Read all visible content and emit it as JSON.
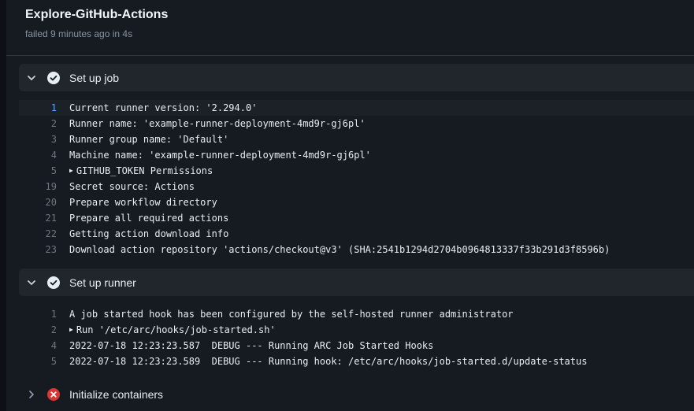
{
  "header": {
    "title": "Explore-GitHub-Actions",
    "subtitle": "failed 9 minutes ago in 4s"
  },
  "steps": [
    {
      "label": "Set up job",
      "status": "success",
      "icon": "check-circle-icon",
      "expanded": true,
      "lines": [
        {
          "num": "1",
          "text": "Current runner version: '2.294.0'",
          "highlight": true
        },
        {
          "num": "2",
          "text": "Runner name: 'example-runner-deployment-4md9r-gj6pl'"
        },
        {
          "num": "3",
          "text": "Runner group name: 'Default'"
        },
        {
          "num": "4",
          "text": "Machine name: 'example-runner-deployment-4md9r-gj6pl'"
        },
        {
          "num": "5",
          "text": "GITHUB_TOKEN Permissions",
          "collapsible": true
        },
        {
          "num": "19",
          "text": "Secret source: Actions"
        },
        {
          "num": "20",
          "text": "Prepare workflow directory"
        },
        {
          "num": "21",
          "text": "Prepare all required actions"
        },
        {
          "num": "22",
          "text": "Getting action download info"
        },
        {
          "num": "23",
          "text": "Download action repository 'actions/checkout@v3' (SHA:2541b1294d2704b0964813337f33b291d3f8596b)"
        }
      ]
    },
    {
      "label": "Set up runner",
      "status": "success",
      "icon": "check-circle-icon",
      "expanded": true,
      "lines": [
        {
          "num": "1",
          "text": "A job started hook has been configured by the self-hosted runner administrator"
        },
        {
          "num": "2",
          "text": "Run '/etc/arc/hooks/job-started.sh'",
          "collapsible": true
        },
        {
          "num": "4",
          "text": "2022-07-18 12:23:23.587  DEBUG --- Running ARC Job Started Hooks"
        },
        {
          "num": "5",
          "text": "2022-07-18 12:23:23.589  DEBUG --- Running hook: /etc/arc/hooks/job-started.d/update-status"
        }
      ]
    },
    {
      "label": "Initialize containers",
      "status": "failure",
      "icon": "x-circle-icon",
      "expanded": false,
      "lines": []
    }
  ],
  "colors": {
    "success": "#e6edf3",
    "failure": "#da3633",
    "background": "#161b22",
    "step_header": "#21262d"
  }
}
